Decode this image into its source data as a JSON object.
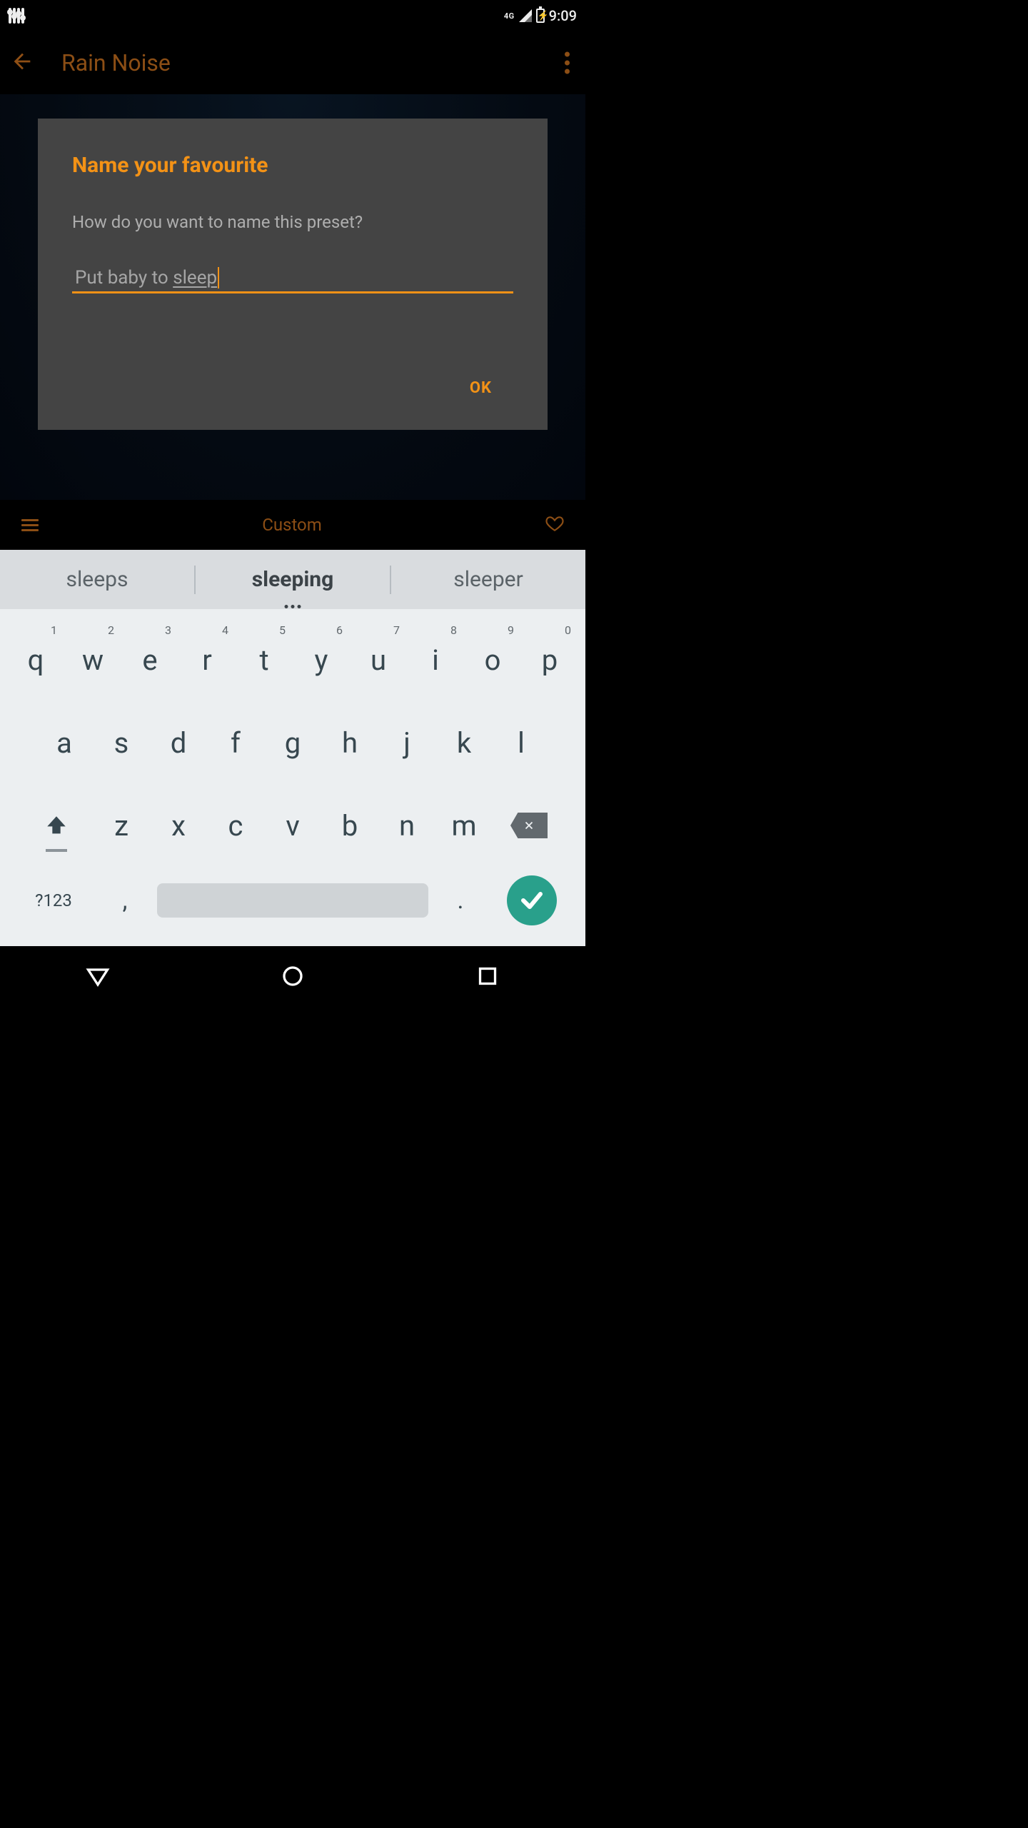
{
  "status": {
    "network_label": "4G",
    "clock": "9:09"
  },
  "app_bar": {
    "title": "Rain Noise"
  },
  "dialog": {
    "title": "Name your favourite",
    "message": "How do you want to name this preset?",
    "input_prefix": "Put baby to ",
    "input_underlined": "sleep",
    "ok_label": "OK"
  },
  "bottom_strip": {
    "custom_label": "Custom"
  },
  "keyboard": {
    "suggestions": {
      "left": "sleeps",
      "mid": "sleeping",
      "right": "sleeper"
    },
    "row1": [
      {
        "ch": "q",
        "num": "1"
      },
      {
        "ch": "w",
        "num": "2"
      },
      {
        "ch": "e",
        "num": "3"
      },
      {
        "ch": "r",
        "num": "4"
      },
      {
        "ch": "t",
        "num": "5"
      },
      {
        "ch": "y",
        "num": "6"
      },
      {
        "ch": "u",
        "num": "7"
      },
      {
        "ch": "i",
        "num": "8"
      },
      {
        "ch": "o",
        "num": "9"
      },
      {
        "ch": "p",
        "num": "0"
      }
    ],
    "row2": [
      "a",
      "s",
      "d",
      "f",
      "g",
      "h",
      "j",
      "k",
      "l"
    ],
    "row3": [
      "z",
      "x",
      "c",
      "v",
      "b",
      "n",
      "m"
    ],
    "sym_label": "?123",
    "comma": ",",
    "period": "."
  },
  "colors": {
    "accent": "#f39216",
    "accent_dim": "#8c4e15",
    "enter": "#29a08b"
  }
}
